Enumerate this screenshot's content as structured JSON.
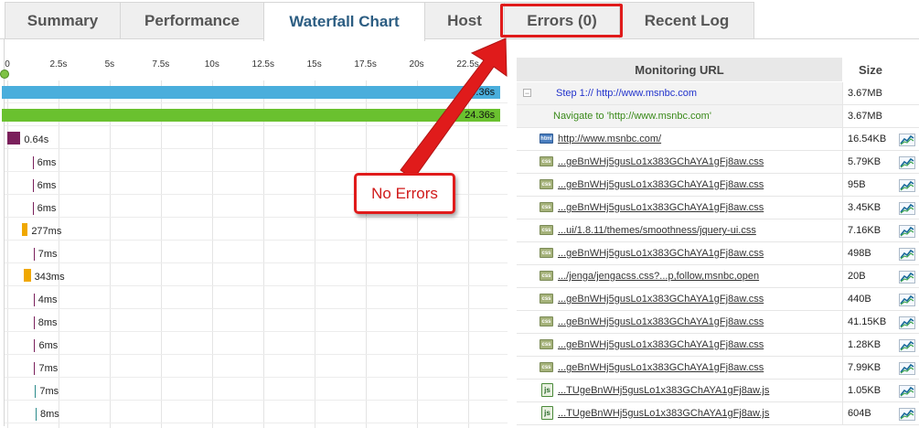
{
  "tabs": [
    {
      "label": "Summary",
      "active": false
    },
    {
      "label": "Performance",
      "active": false
    },
    {
      "label": "Waterfall Chart",
      "active": true
    },
    {
      "label": "Host",
      "active": false
    },
    {
      "label": "Errors (0)",
      "active": false
    },
    {
      "label": "Recent Log",
      "active": false
    }
  ],
  "waterfall": {
    "axis_labels": [
      "0",
      "2.5s",
      "5s",
      "7.5s",
      "10s",
      "12.5s",
      "15s",
      "17.5s",
      "20s",
      "22.5s"
    ],
    "axis_max_seconds": 24.5,
    "rows": [
      {
        "duration": "24.36s",
        "kind": "step",
        "start": 0,
        "value": 24.36,
        "label_inside": true
      },
      {
        "duration": "24.36s",
        "kind": "navigate",
        "start": 0,
        "value": 24.36,
        "label_inside": true
      },
      {
        "duration": "0.64s",
        "kind": "html",
        "start": 0,
        "value": 0.64
      },
      {
        "duration": "6ms",
        "kind": "tick",
        "start": 0.7,
        "value": 0.006
      },
      {
        "duration": "6ms",
        "kind": "tick",
        "start": 0.7,
        "value": 0.006
      },
      {
        "duration": "6ms",
        "kind": "tick",
        "start": 0.7,
        "value": 0.006
      },
      {
        "duration": "277ms",
        "kind": "wait",
        "start": 0.72,
        "value": 0.277
      },
      {
        "duration": "7ms",
        "kind": "tick",
        "start": 0.75,
        "value": 0.007
      },
      {
        "duration": "343ms",
        "kind": "wait",
        "start": 0.8,
        "value": 0.343
      },
      {
        "duration": "4ms",
        "kind": "tick",
        "start": 0.75,
        "value": 0.004
      },
      {
        "duration": "8ms",
        "kind": "tick",
        "start": 0.75,
        "value": 0.008
      },
      {
        "duration": "6ms",
        "kind": "tick",
        "start": 0.78,
        "value": 0.006
      },
      {
        "duration": "7ms",
        "kind": "tick",
        "start": 0.78,
        "value": 0.007
      },
      {
        "duration": "7ms",
        "kind": "tick-teal",
        "start": 0.82,
        "value": 0.007
      },
      {
        "duration": "8ms",
        "kind": "tick-teal",
        "start": 0.85,
        "value": 0.008
      }
    ],
    "colors": {
      "step": "#4aaedc",
      "navigate": "#6ac12f",
      "wait": "#f0a800",
      "tick": "#7a1f5b",
      "tick-teal": "#2a8a8a"
    }
  },
  "table": {
    "header_url": "Monitoring URL",
    "header_size": "Size",
    "rows": [
      {
        "type": "step",
        "url": "Step 1:// http://www.msnbc.com",
        "size": "3.67MB"
      },
      {
        "type": "navigate",
        "url": "Navigate to 'http://www.msnbc.com'",
        "size": "3.67MB"
      },
      {
        "type": "html",
        "url": "http://www.msnbc.com/",
        "size": "16.54KB"
      },
      {
        "type": "css",
        "url": "...geBnWHj5gusLo1x383GChAYA1gFj8aw.css",
        "size": "5.79KB"
      },
      {
        "type": "css",
        "url": "...geBnWHj5gusLo1x383GChAYA1gFj8aw.css",
        "size": "95B"
      },
      {
        "type": "css",
        "url": "...geBnWHj5gusLo1x383GChAYA1gFj8aw.css",
        "size": "3.45KB"
      },
      {
        "type": "css",
        "url": "...ui/1.8.11/themes/smoothness/jquery-ui.css",
        "size": "7.16KB"
      },
      {
        "type": "css",
        "url": "...geBnWHj5gusLo1x383GChAYA1gFj8aw.css",
        "size": "498B"
      },
      {
        "type": "css",
        "url": ".../jenga/jengacss.css?...p,follow,msnbc,open",
        "size": "20B"
      },
      {
        "type": "css",
        "url": "...geBnWHj5gusLo1x383GChAYA1gFj8aw.css",
        "size": "440B"
      },
      {
        "type": "css",
        "url": "...geBnWHj5gusLo1x383GChAYA1gFj8aw.css",
        "size": "41.15KB"
      },
      {
        "type": "css",
        "url": "...geBnWHj5gusLo1x383GChAYA1gFj8aw.css",
        "size": "1.28KB"
      },
      {
        "type": "css",
        "url": "...geBnWHj5gusLo1x383GChAYA1gFj8aw.css",
        "size": "7.99KB"
      },
      {
        "type": "js",
        "url": "...TUgeBnWHj5gusLo1x383GChAYA1gFj8aw.js",
        "size": "1.05KB"
      },
      {
        "type": "js",
        "url": "...TUgeBnWHj5gusLo1x383GChAYA1gFj8aw.js",
        "size": "604B"
      }
    ]
  },
  "annotation": {
    "callout_text": "No Errors",
    "color": "#e01b1b"
  },
  "icons": {
    "collapse": "−",
    "css": "css",
    "html": "html",
    "js": "js"
  }
}
